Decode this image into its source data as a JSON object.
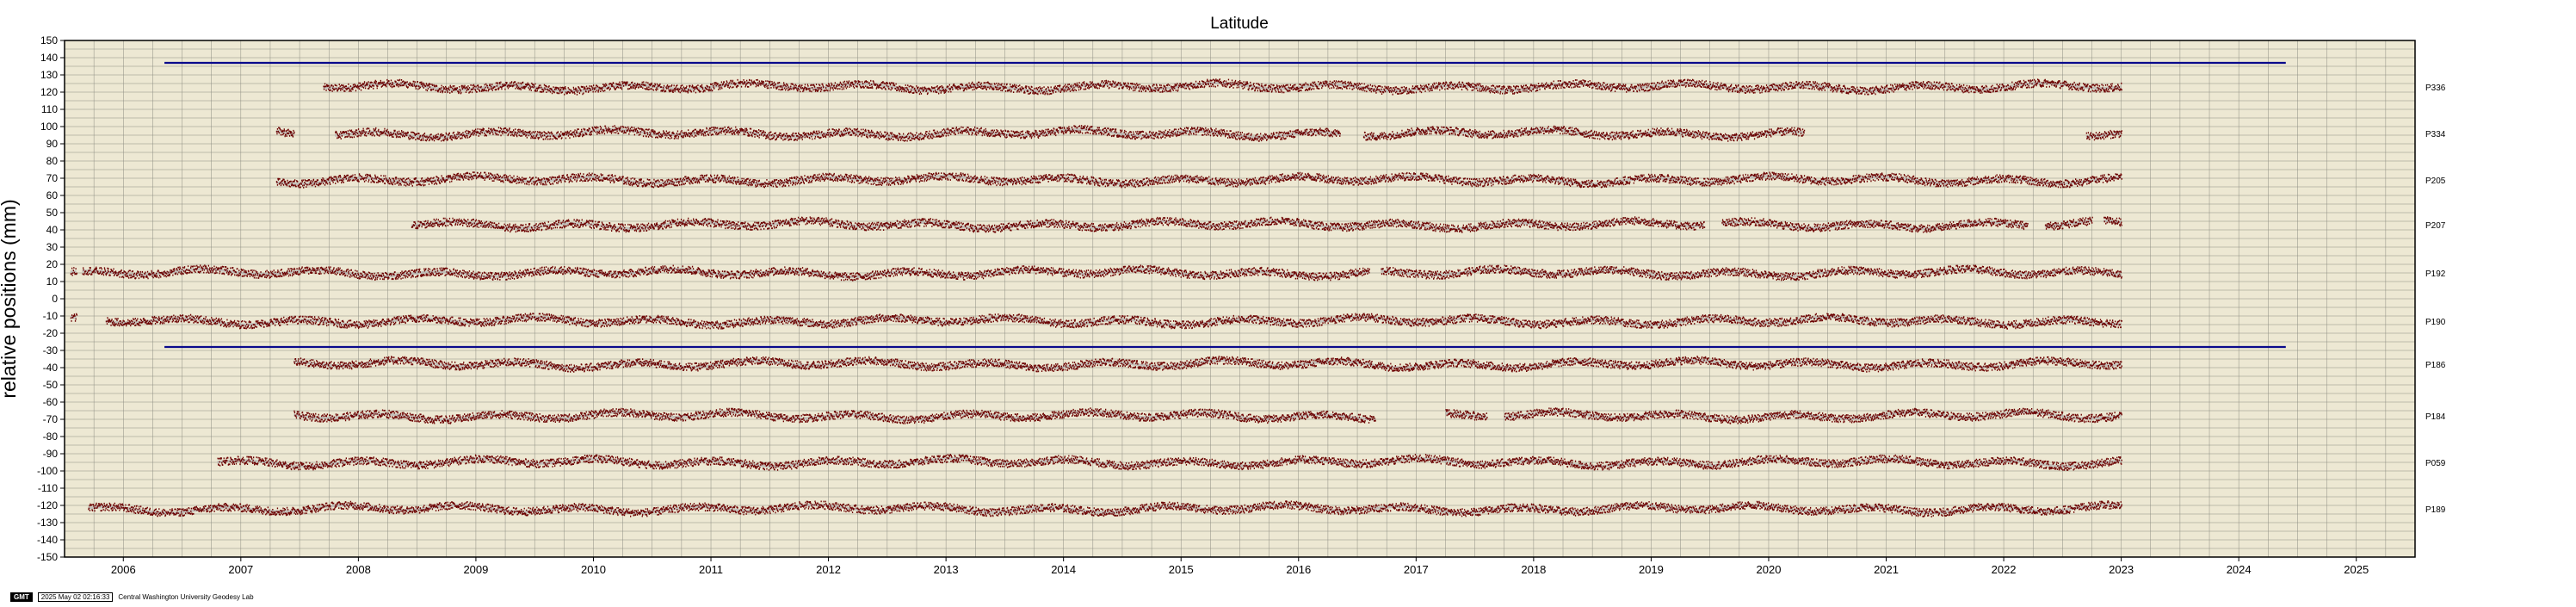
{
  "chart_data": {
    "type": "scatter",
    "title": "Latitude",
    "ylabel": "relative positions (mm)",
    "xlabel": "",
    "xlim": [
      2005.5,
      2025.5
    ],
    "ylim": [
      -150,
      150
    ],
    "y_ticks": [
      150,
      140,
      130,
      120,
      110,
      100,
      90,
      80,
      70,
      60,
      50,
      40,
      30,
      20,
      10,
      0,
      -10,
      -20,
      -30,
      -40,
      -50,
      -60,
      -70,
      -80,
      -90,
      -100,
      -110,
      -120,
      -130,
      -140,
      -150
    ],
    "y_tick_labels": [
      "150",
      "140",
      "130",
      "120",
      "110",
      "100",
      "90",
      "80",
      "70",
      "60",
      "50",
      "40",
      "30",
      "20",
      "10",
      "0",
      "-10",
      "-20",
      "-30",
      "-40",
      "-50",
      "-60",
      "-70",
      "-80",
      "-90",
      "-100",
      "-110",
      "-120",
      "-130",
      "-140",
      "-150"
    ],
    "x_ticks": [
      2006,
      2007,
      2008,
      2009,
      2010,
      2011,
      2012,
      2013,
      2014,
      2015,
      2016,
      2017,
      2018,
      2019,
      2020,
      2021,
      2022,
      2023,
      2024,
      2025
    ],
    "x_tick_labels": [
      "2006",
      "2007",
      "2008",
      "2009",
      "2010",
      "2011",
      "2012",
      "2013",
      "2014",
      "2015",
      "2016",
      "2017",
      "2018",
      "2019",
      "2020",
      "2021",
      "2022",
      "2023",
      "2024",
      "2025"
    ],
    "grid": true,
    "background_color": "#ede8d3",
    "point_color": "#6b0000",
    "fit_color": "#b0b0b0",
    "reference_line_color": "#0a0a8c",
    "reference_lines": [
      {
        "y": 137,
        "x": [
          2006.35,
          2024.4
        ]
      },
      {
        "y": -28,
        "x": [
          2006.35,
          2024.4
        ]
      }
    ],
    "series": [
      {
        "name": "P336",
        "offset": 123,
        "segments": [
          [
            2007.7,
            2023.0
          ]
        ]
      },
      {
        "name": "P334",
        "offset": 96,
        "segments": [
          [
            2007.3,
            2007.45
          ],
          [
            2007.8,
            2016.35
          ],
          [
            2016.55,
            2020.3
          ],
          [
            2022.7,
            2023.0
          ]
        ]
      },
      {
        "name": "P205",
        "offset": 69,
        "segments": [
          [
            2007.3,
            2023.0
          ]
        ]
      },
      {
        "name": "P207",
        "offset": 43,
        "segments": [
          [
            2008.45,
            2019.45
          ],
          [
            2019.6,
            2022.2
          ],
          [
            2022.35,
            2022.75
          ],
          [
            2022.85,
            2023.0
          ]
        ]
      },
      {
        "name": "P192",
        "offset": 15,
        "segments": [
          [
            2005.55,
            2005.6
          ],
          [
            2005.65,
            2016.6
          ],
          [
            2016.7,
            2023.0
          ]
        ]
      },
      {
        "name": "P190",
        "offset": -13,
        "segments": [
          [
            2005.55,
            2005.6
          ],
          [
            2005.85,
            2023.0
          ]
        ]
      },
      {
        "name": "P186",
        "offset": -38,
        "segments": [
          [
            2007.45,
            2023.0
          ]
        ]
      },
      {
        "name": "P184",
        "offset": -68,
        "segments": [
          [
            2007.45,
            2016.65
          ],
          [
            2017.25,
            2017.6
          ],
          [
            2017.75,
            2023.0
          ]
        ]
      },
      {
        "name": "P059",
        "offset": -95,
        "segments": [
          [
            2006.8,
            2023.0
          ]
        ]
      },
      {
        "name": "P189",
        "offset": -122,
        "segments": [
          [
            2005.7,
            2023.0
          ]
        ]
      }
    ]
  },
  "footer": {
    "logo": "GMT",
    "timestamp": "2025 May 02 02:16:33",
    "credit": "Central Washington University Geodesy Lab"
  }
}
